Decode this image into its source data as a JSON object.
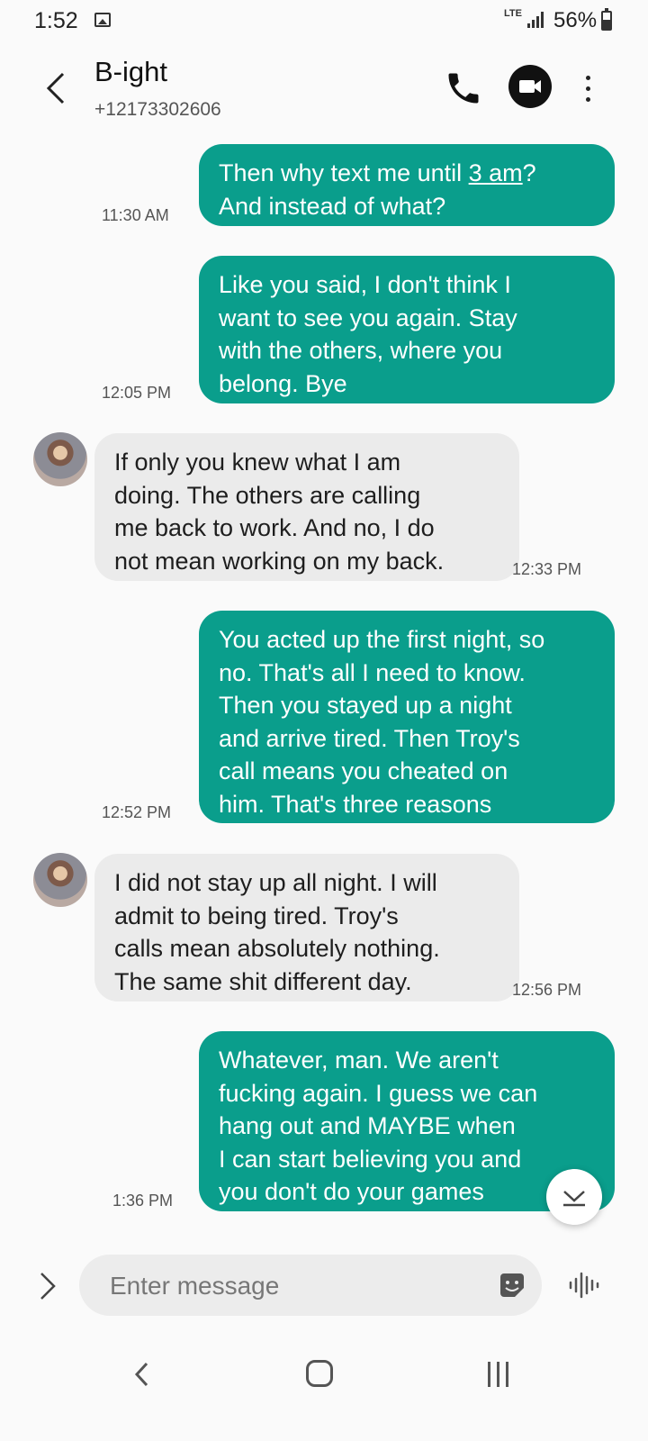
{
  "status_bar": {
    "time": "1:52",
    "network": "LTE",
    "battery": "56%",
    "battery_level": 0.56
  },
  "header": {
    "contact_name": "B-ight",
    "contact_number": "+12173302606"
  },
  "messages": [
    {
      "direction": "sent",
      "lines": [
        "Then why text me until ",
        "3 am",
        "?",
        "And instead of what?"
      ],
      "time": "11:30 AM"
    },
    {
      "direction": "sent",
      "lines": [
        "Like you said, I don't think I",
        "want to see you again. Stay",
        "with the others, where you",
        "belong. Bye"
      ],
      "time": "12:05 PM"
    },
    {
      "direction": "received",
      "lines": [
        "If only you knew what I am",
        "doing.  The others are calling",
        "me back to work.  And no, I do",
        "not mean working on my back."
      ],
      "time": "12:33 PM"
    },
    {
      "direction": "sent",
      "lines": [
        "You acted up the first night, so",
        "no. That's all I need to know.",
        "Then you stayed up a night",
        "and arrive tired. Then Troy's",
        "call means you cheated on",
        "him. That's three reasons"
      ],
      "time": "12:52 PM"
    },
    {
      "direction": "received",
      "lines": [
        "I did not stay up all night.  I will",
        "admit to being tired.  Troy's",
        "calls mean absolutely nothing.",
        "The same shit different day."
      ],
      "time": "12:56 PM"
    },
    {
      "direction": "sent",
      "lines": [
        "Whatever, man. We aren't",
        "fucking again. I guess we can",
        "hang out and MAYBE when",
        "I can start believing you and",
        "you don't do your games"
      ],
      "time": "1:36 PM"
    }
  ],
  "composer": {
    "placeholder": "Enter message"
  },
  "colors": {
    "sent_bubble": "#0a9e8c",
    "received_bubble": "#ebebeb",
    "background": "#fafafa"
  },
  "icons": [
    "back-icon",
    "call-icon",
    "video-call-icon",
    "more-options-icon",
    "expand-icon",
    "sticker-icon",
    "voice-input-icon",
    "scroll-down-icon",
    "nav-back-icon",
    "nav-home-icon",
    "nav-recents-icon"
  ]
}
